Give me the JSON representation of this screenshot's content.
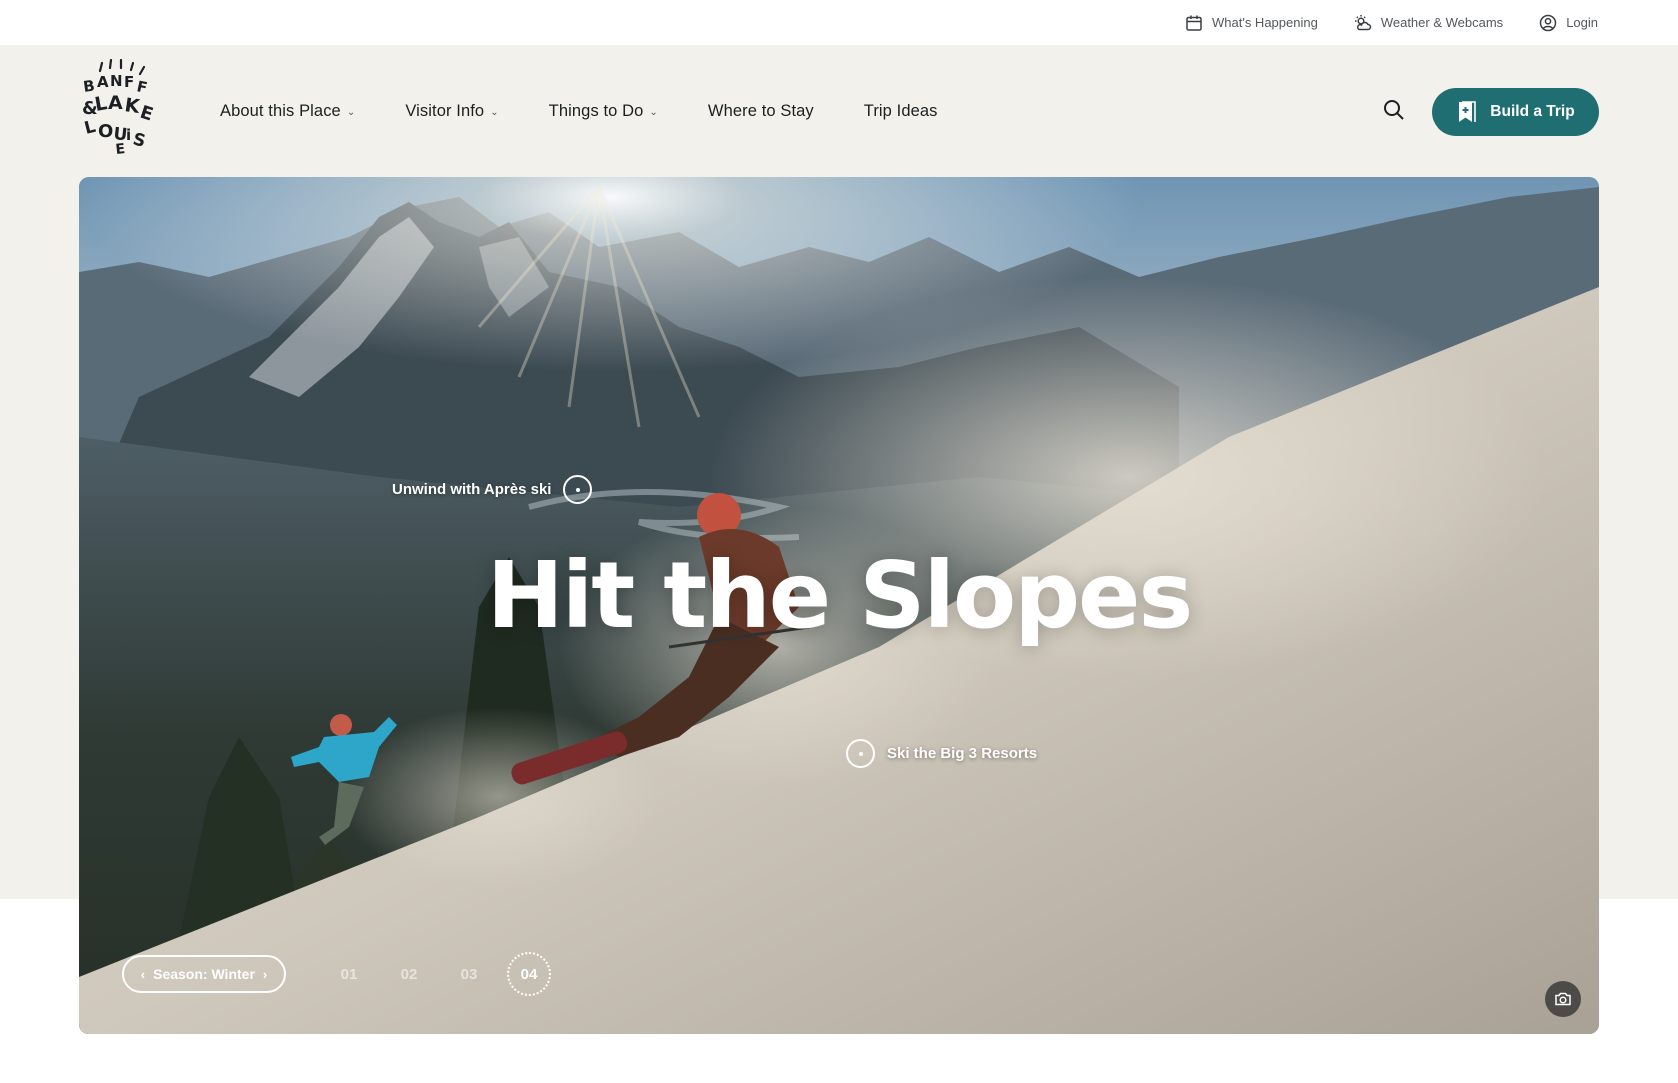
{
  "utility": {
    "whats_happening": "What's Happening",
    "weather": "Weather & Webcams",
    "login": "Login"
  },
  "logo": {
    "lines": [
      "BANFF",
      "&LAKE",
      "LOUISE"
    ]
  },
  "nav": {
    "items": [
      {
        "label": "About this Place",
        "dropdown": true
      },
      {
        "label": "Visitor Info",
        "dropdown": true
      },
      {
        "label": "Things to Do",
        "dropdown": true
      },
      {
        "label": "Where to Stay",
        "dropdown": false
      },
      {
        "label": "Trip Ideas",
        "dropdown": false
      }
    ],
    "cta": "Build a Trip"
  },
  "hero": {
    "title": "Hit the Slopes",
    "hotspots": [
      {
        "label": "Unwind with Après ski"
      },
      {
        "label": "Ski the Big 3 Resorts"
      }
    ],
    "season": "Season: Winter",
    "slides": [
      "01",
      "02",
      "03",
      "04"
    ],
    "active_slide": "04"
  },
  "colors": {
    "accent": "#1f6f72",
    "cream": "#f3f1ec"
  }
}
